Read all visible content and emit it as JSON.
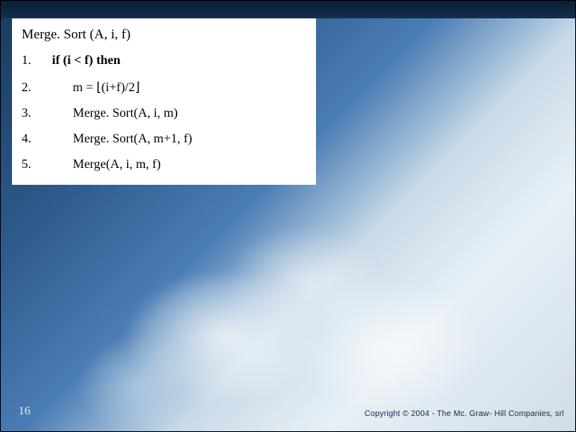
{
  "slide": {
    "title": "Merge. Sort (A, i, f)",
    "lines": [
      {
        "num": "1.",
        "text": "if (i  < f) then",
        "bold": true,
        "indent": false
      },
      {
        "num": "2.",
        "text": "m = ⌊(i+f)/2⌋",
        "bold": false,
        "indent": true
      },
      {
        "num": "3.",
        "text": "Merge. Sort(A, i, m)",
        "bold": false,
        "indent": true
      },
      {
        "num": "4.",
        "text": "Merge. Sort(A, m+1, f)",
        "bold": false,
        "indent": true
      },
      {
        "num": "5.",
        "text": "Merge(A, i, m, f)",
        "bold": false,
        "indent": true
      }
    ],
    "number": "16",
    "copyright": "Copyright © 2004 - The Mc. Graw- Hill Companies, srl"
  }
}
